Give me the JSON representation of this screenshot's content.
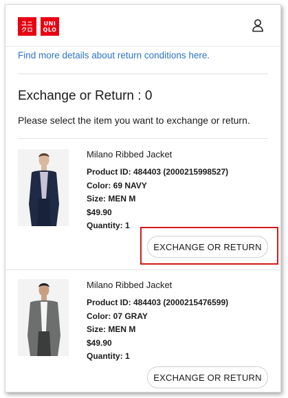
{
  "header": {
    "logo": {
      "box1": [
        "ユニ",
        "クロ"
      ],
      "box2": [
        "UNI",
        "QLO"
      ]
    },
    "user_icon": "user-icon"
  },
  "details_link": "Find more details about return conditions here.",
  "page_title": "Exchange or Return : 0",
  "instruction": "Please select the item you want to exchange or return.",
  "items": [
    {
      "name": "Milano Ribbed Jacket",
      "product_id": "Product ID: 484403 (2000215998527)",
      "color": "Color: 69 NAVY",
      "size": "Size: MEN M",
      "price": "$49.90",
      "quantity": "Quantity: 1",
      "button_label": "EXCHANGE OR RETURN",
      "photo_color": "#1f2a44",
      "highlighted": true
    },
    {
      "name": "Milano Ribbed Jacket",
      "product_id": "Product ID: 484403 (2000215476599)",
      "color": "Color: 07 GRAY",
      "size": "Size: MEN M",
      "price": "$49.90",
      "quantity": "Quantity: 1",
      "button_label": "EXCHANGE OR RETURN",
      "photo_color": "#6c6f6e",
      "highlighted": false
    }
  ],
  "colors": {
    "brand_red": "#e60012",
    "link_blue": "#2b73c7",
    "highlight_red": "#d11a1a"
  }
}
